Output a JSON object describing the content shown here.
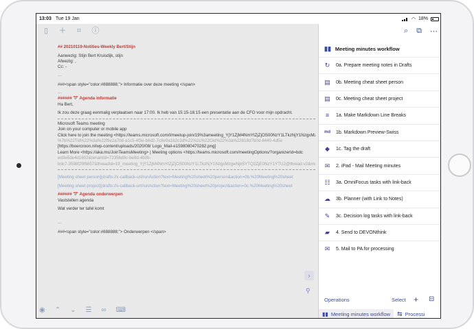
{
  "status": {
    "time": "13:03",
    "date": "Tue 19 Jan",
    "battery": "18%"
  },
  "editor": {
    "lines": [
      {
        "t": "## 20210119-Notities-Weekly Bert/Stijn",
        "c": "hd"
      },
      {
        "t": "",
        "c": "gap"
      },
      {
        "t": "Aanwezig: Stijn                    Bert Kruisdijk, stijn",
        "c": ""
      },
      {
        "t": "Afwezig: ,",
        "c": ""
      },
      {
        "t": "Cc: -",
        "c": ""
      },
      {
        "t": "",
        "c": "gap"
      },
      {
        "t": "---",
        "c": "dim"
      },
      {
        "t": "",
        "c": "gap"
      },
      {
        "t": "###<span style=\"color:#888888;\"> Informatie over deze meeting </span>",
        "c": ""
      },
      {
        "t": "",
        "c": "gap"
      },
      {
        "t": "---",
        "c": "dim"
      },
      {
        "t": "###### 📅 Agenda informatie",
        "c": "hd"
      },
      {
        "t": "Ha Bert,",
        "c": ""
      },
      {
        "t": "",
        "c": "gap"
      },
      {
        "t": "Ik zou deze graag eenmalig verplaatsen naar 17:00. Ik heb van 15:15-16:15 een presentatie aan de CFO voor mijn opdracht.",
        "c": ""
      },
      {
        "t": "",
        "c": "sep"
      },
      {
        "t": "Microsoft Teams meeting",
        "c": ""
      },
      {
        "t": "Join on your computer or mobile app",
        "c": ""
      },
      {
        "t": "Click here to join the meeting <https://teams.microsoft.com/l/meetup-join/19%3ameeting_YjY1ZjM4NmYtZjZjOS00NzY1LTkzNjY1NzgxMzgwNjk5YTQ2ZjE0NzY1YTU2>",
        "c": ""
      },
      {
        "t": "%7b%22Tid%22%3a%22f9e2a7b8-a1c5-4f3e-b6d2-7c8e9a1b2c3d%22%2c%22Oid%22%3a%22818d7b0d-8440-4d5e",
        "c": "dim"
      },
      {
        "t": "[https://boercroon.nl/wp-content/uploads/2020/08/                    Logo_Mail-e1598080470282.png]",
        "c": ""
      },
      {
        "t": "Learn More <https://aka.ms/JoinTeamsMeeting> | Meeting options <https://teams.microsoft.com/meetingOptions/?organizerId=bdc",
        "c": ""
      },
      {
        "t": "ed3e5de4d1602&tenantId=7235bd8c-be8d-4b3b-",
        "c": "dim"
      },
      {
        "t": "bdc7-3598f29f6857&threadId=19_meeting_YjY1ZjM4NmYtZjZjOS00NzY1LTkzNjY1NzgxMzgwNjk5YTQ2ZjE0NzY1YTU2@thread.v2&messageId=0&language=nl-NL>",
        "c": "dim"
      },
      {
        "t": "",
        "c": "sep"
      },
      {
        "t": "",
        "c": "gap"
      },
      {
        "t": "[Meeting sheet person](drafts://x-callback-url/runAction?text=Meeting%20sheet%20person&action=0b.%20Meeting%20sheet",
        "c": "blue"
      },
      {
        "t": "",
        "c": "gap"
      },
      {
        "t": "[Meeting sheet project](drafts://x-callback-url/runAction?text=Meeting%20sheet%20project&action=0c.%20Meeting%20sheet",
        "c": "blue"
      },
      {
        "t": "",
        "c": "gap"
      },
      {
        "t": "###### 📅 Agenda onderwerpen",
        "c": "hd"
      },
      {
        "t": "Vaststellen agenda",
        "c": ""
      },
      {
        "t": "",
        "c": "gap"
      },
      {
        "t": "Wat verder ter tafel komt",
        "c": ""
      },
      {
        "t": "",
        "c": "gap"
      },
      {
        "t": "",
        "c": "gap"
      },
      {
        "t": "",
        "c": "gap"
      },
      {
        "t": "---",
        "c": "dim"
      },
      {
        "t": "",
        "c": "gap"
      },
      {
        "t": "###<span style=\"color:#888888;\"> Onderwerpen </span>",
        "c": ""
      }
    ]
  },
  "panel": {
    "title": "Meeting minutes workflow",
    "actions": [
      {
        "label": "0a. Prepare meeting notes in Drafts",
        "icon": "refresh-icon"
      },
      {
        "label": "0b. Meeting cheat sheet person",
        "icon": "document-icon"
      },
      {
        "label": "0c. Meeting cheat sheet project",
        "icon": "document-icon"
      },
      {
        "label": "1a. Make Markdown Line Breaks",
        "icon": "lines-icon"
      },
      {
        "label": "1b. Markdown Preview-Swiss",
        "icon": "markdown-icon"
      },
      {
        "label": "1c. Tag the draft",
        "icon": "tag-icon"
      },
      {
        "label": "2. iPad - Mail Meeting minutes",
        "icon": "mail-icon"
      },
      {
        "label": "3a. OmniFocus tasks with link-back",
        "icon": "checklist-icon"
      },
      {
        "label": "3b. Planner (with Link to Notes)",
        "icon": "cloud-icon"
      },
      {
        "label": "3c. Decision log tasks with link-back",
        "icon": "pen-icon"
      },
      {
        "label": "4. Send to DEVONthink",
        "icon": "folder-icon"
      },
      {
        "label": "5. Mail to PA for processing",
        "icon": "mail-icon"
      }
    ],
    "operations": "Operations",
    "select": "Select",
    "tabs": [
      "Meeting minutes workflow",
      "Processi"
    ]
  }
}
